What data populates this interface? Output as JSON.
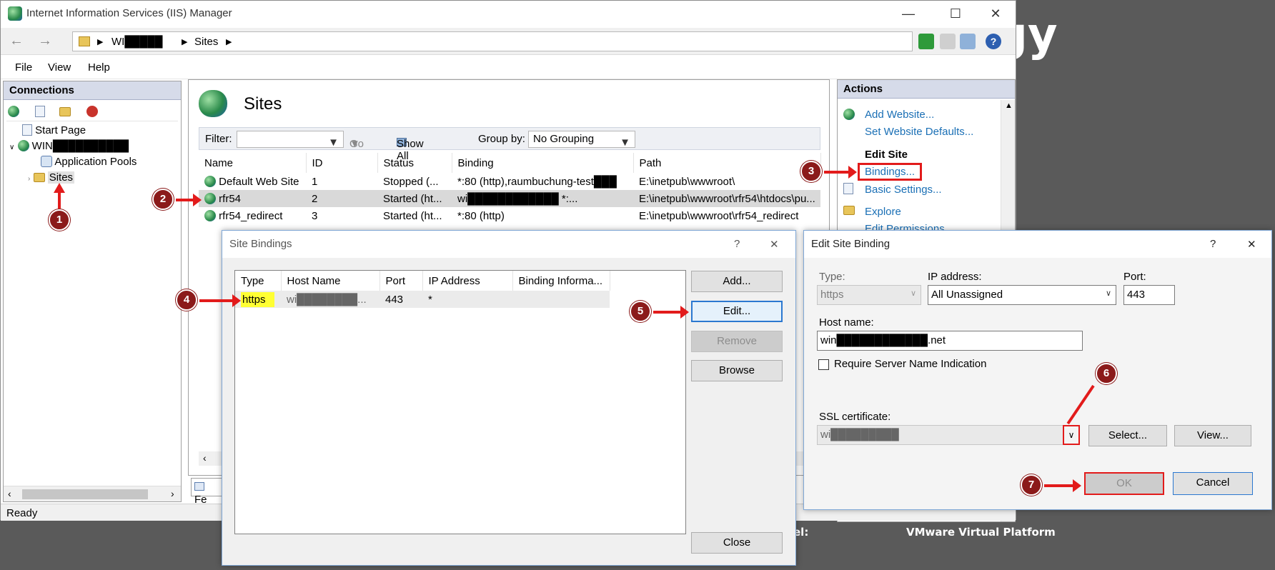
{
  "background": {
    "big_text": "gy",
    "label_fragment_1": "el:",
    "vm_platform": "VMware Virtual Platform"
  },
  "window": {
    "title": "Internet Information Services (IIS) Manager",
    "breadcrumb": [
      "WI█████",
      "Sites"
    ],
    "menu": [
      "File",
      "View",
      "Help"
    ],
    "status": "Ready"
  },
  "connections": {
    "header": "Connections",
    "tree": {
      "start_page": "Start Page",
      "server": "WIN██████████",
      "app_pools": "Application Pools",
      "sites": "Sites"
    }
  },
  "sites": {
    "title": "Sites",
    "filter_label": "Filter:",
    "go_label": "Go",
    "show_all_label": "Show All",
    "group_by_label": "Group by:",
    "group_by_value": "No Grouping",
    "columns": [
      "Name",
      "ID",
      "Status",
      "Binding",
      "Path"
    ],
    "rows": [
      {
        "name": "Default Web Site",
        "id": "1",
        "status": "Stopped (...",
        "binding": "*:80 (http),raumbuchung-test███",
        "path": "E:\\inetpub\\wwwroot\\"
      },
      {
        "name": "rfr54",
        "id": "2",
        "status": "Started (ht...",
        "binding": "wi████████████ *:...",
        "path": "E:\\inetpub\\wwwroot\\rfr54\\htdocs\\pu..."
      },
      {
        "name": "rfr54_redirect",
        "id": "3",
        "status": "Started (ht...",
        "binding": "*:80 (http)",
        "path": "E:\\inetpub\\wwwroot\\rfr54_redirect"
      }
    ],
    "bottom_tab": "Fe"
  },
  "actions": {
    "header": "Actions",
    "add_website": "Add Website...",
    "set_defaults": "Set Website Defaults...",
    "edit_site_header": "Edit Site",
    "bindings": "Bindings...",
    "basic_settings": "Basic Settings...",
    "explore": "Explore",
    "edit_permissions": "Edit Permissions..."
  },
  "site_bindings": {
    "title": "Site Bindings",
    "help": "?",
    "close_x": "✕",
    "columns": [
      "Type",
      "Host Name",
      "Port",
      "IP Address",
      "Binding Informa..."
    ],
    "row": {
      "type": "https",
      "host": "wi████████...",
      "port": "443",
      "ip": "*",
      "info": ""
    },
    "buttons": {
      "add": "Add...",
      "edit": "Edit...",
      "remove": "Remove",
      "browse": "Browse",
      "close": "Close"
    }
  },
  "edit_binding": {
    "title": "Edit Site Binding",
    "help": "?",
    "close_x": "✕",
    "type_label": "Type:",
    "type_value": "https",
    "ip_label": "IP address:",
    "ip_value": "All Unassigned",
    "port_label": "Port:",
    "port_value": "443",
    "host_label": "Host name:",
    "host_value": "win████████████.net",
    "sni_label": "Require Server Name Indication",
    "ssl_label": "SSL certificate:",
    "ssl_value": "wi█████████",
    "buttons": {
      "select": "Select...",
      "view": "View...",
      "ok": "OK",
      "cancel": "Cancel"
    }
  },
  "annotations": [
    "1",
    "2",
    "3",
    "4",
    "5",
    "6",
    "7"
  ],
  "colors": {
    "annotation": "#8b1a1a",
    "arrow": "#e21b1b",
    "link": "#1a6fb5",
    "highlight": "#ffff33"
  }
}
